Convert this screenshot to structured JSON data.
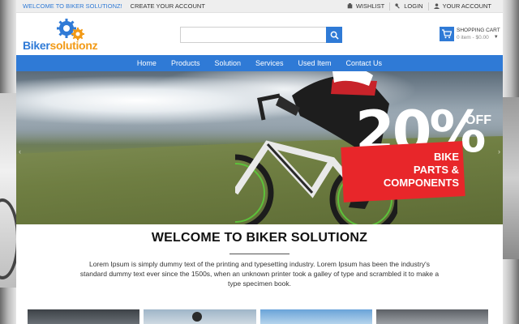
{
  "topbar": {
    "welcome": "WELCOME TO BIKER SOLUTIONZ!",
    "create_account": "CREATE YOUR ACCOUNT",
    "wishlist": "WISHLIST",
    "login": "LOGIN",
    "your_account": "YOUR ACCOUNT"
  },
  "logo": {
    "part1": "Biker",
    "part2": "solutionz"
  },
  "search": {
    "value": "",
    "placeholder": ""
  },
  "cart": {
    "title": "SHOPPING CART",
    "summary": "0 item - $0.00"
  },
  "nav": {
    "items": [
      {
        "label": "Home"
      },
      {
        "label": "Products"
      },
      {
        "label": "Solution"
      },
      {
        "label": "Services"
      },
      {
        "label": "Used Item"
      },
      {
        "label": "Contact Us"
      }
    ]
  },
  "hero": {
    "discount": "20%",
    "off": "OFF",
    "line1": "BIKE",
    "line2": "PARTS &",
    "line3": "COMPONENTS"
  },
  "welcome_section": {
    "title": "WELCOME TO BIKER SOLUTIONZ",
    "body": "Lorem Ipsum is simply dummy text of the printing and typesetting industry. Lorem Ipsum has been the industry's standard dummy text ever since the 1500s, when an unknown printer took a galley of type and scrambled it to make a type specimen book."
  },
  "colors": {
    "brand_blue": "#2f7ad6",
    "brand_orange": "#f29a16",
    "promo_red": "#e8262a"
  },
  "icons": [
    "wishlist-icon",
    "login-icon",
    "account-icon",
    "search-icon",
    "cart-icon",
    "gear-icon"
  ]
}
